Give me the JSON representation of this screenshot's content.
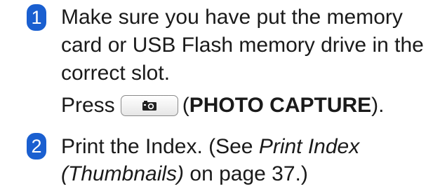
{
  "step1": {
    "number": "1",
    "line1": "Make sure you have put the memory",
    "line2": "card or USB Flash memory drive in the",
    "line3": "correct slot.",
    "press_prefix": "Press",
    "paren_open": "(",
    "key_label": "PHOTO CAPTURE",
    "paren_close": ").",
    "key_icon": "camera-icon"
  },
  "step2": {
    "number": "2",
    "text1": "Print the Index. (See ",
    "italic1": "Print Index",
    "italic2": "(Thumbnails)",
    "text2": " on page 37.)"
  },
  "colors": {
    "badge": "#1a5fd0"
  }
}
